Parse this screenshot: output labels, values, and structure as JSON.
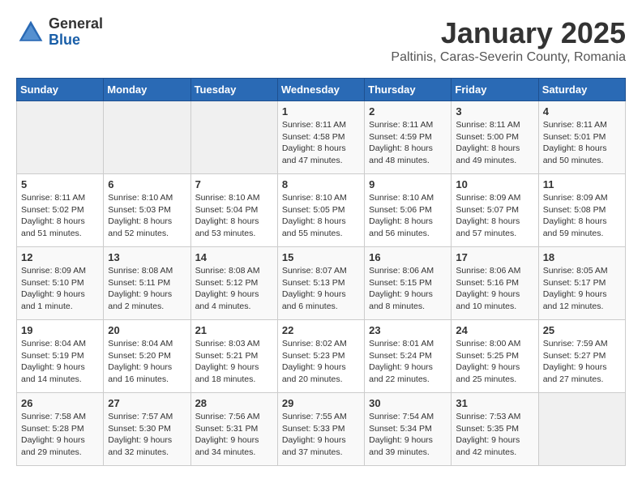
{
  "logo": {
    "general": "General",
    "blue": "Blue"
  },
  "header": {
    "title": "January 2025",
    "subtitle": "Paltinis, Caras-Severin County, Romania"
  },
  "weekdays": [
    "Sunday",
    "Monday",
    "Tuesday",
    "Wednesday",
    "Thursday",
    "Friday",
    "Saturday"
  ],
  "weeks": [
    [
      {
        "day": "",
        "info": ""
      },
      {
        "day": "",
        "info": ""
      },
      {
        "day": "",
        "info": ""
      },
      {
        "day": "1",
        "info": "Sunrise: 8:11 AM\nSunset: 4:58 PM\nDaylight: 8 hours and 47 minutes."
      },
      {
        "day": "2",
        "info": "Sunrise: 8:11 AM\nSunset: 4:59 PM\nDaylight: 8 hours and 48 minutes."
      },
      {
        "day": "3",
        "info": "Sunrise: 8:11 AM\nSunset: 5:00 PM\nDaylight: 8 hours and 49 minutes."
      },
      {
        "day": "4",
        "info": "Sunrise: 8:11 AM\nSunset: 5:01 PM\nDaylight: 8 hours and 50 minutes."
      }
    ],
    [
      {
        "day": "5",
        "info": "Sunrise: 8:11 AM\nSunset: 5:02 PM\nDaylight: 8 hours and 51 minutes."
      },
      {
        "day": "6",
        "info": "Sunrise: 8:10 AM\nSunset: 5:03 PM\nDaylight: 8 hours and 52 minutes."
      },
      {
        "day": "7",
        "info": "Sunrise: 8:10 AM\nSunset: 5:04 PM\nDaylight: 8 hours and 53 minutes."
      },
      {
        "day": "8",
        "info": "Sunrise: 8:10 AM\nSunset: 5:05 PM\nDaylight: 8 hours and 55 minutes."
      },
      {
        "day": "9",
        "info": "Sunrise: 8:10 AM\nSunset: 5:06 PM\nDaylight: 8 hours and 56 minutes."
      },
      {
        "day": "10",
        "info": "Sunrise: 8:09 AM\nSunset: 5:07 PM\nDaylight: 8 hours and 57 minutes."
      },
      {
        "day": "11",
        "info": "Sunrise: 8:09 AM\nSunset: 5:08 PM\nDaylight: 8 hours and 59 minutes."
      }
    ],
    [
      {
        "day": "12",
        "info": "Sunrise: 8:09 AM\nSunset: 5:10 PM\nDaylight: 9 hours and 1 minute."
      },
      {
        "day": "13",
        "info": "Sunrise: 8:08 AM\nSunset: 5:11 PM\nDaylight: 9 hours and 2 minutes."
      },
      {
        "day": "14",
        "info": "Sunrise: 8:08 AM\nSunset: 5:12 PM\nDaylight: 9 hours and 4 minutes."
      },
      {
        "day": "15",
        "info": "Sunrise: 8:07 AM\nSunset: 5:13 PM\nDaylight: 9 hours and 6 minutes."
      },
      {
        "day": "16",
        "info": "Sunrise: 8:06 AM\nSunset: 5:15 PM\nDaylight: 9 hours and 8 minutes."
      },
      {
        "day": "17",
        "info": "Sunrise: 8:06 AM\nSunset: 5:16 PM\nDaylight: 9 hours and 10 minutes."
      },
      {
        "day": "18",
        "info": "Sunrise: 8:05 AM\nSunset: 5:17 PM\nDaylight: 9 hours and 12 minutes."
      }
    ],
    [
      {
        "day": "19",
        "info": "Sunrise: 8:04 AM\nSunset: 5:19 PM\nDaylight: 9 hours and 14 minutes."
      },
      {
        "day": "20",
        "info": "Sunrise: 8:04 AM\nSunset: 5:20 PM\nDaylight: 9 hours and 16 minutes."
      },
      {
        "day": "21",
        "info": "Sunrise: 8:03 AM\nSunset: 5:21 PM\nDaylight: 9 hours and 18 minutes."
      },
      {
        "day": "22",
        "info": "Sunrise: 8:02 AM\nSunset: 5:23 PM\nDaylight: 9 hours and 20 minutes."
      },
      {
        "day": "23",
        "info": "Sunrise: 8:01 AM\nSunset: 5:24 PM\nDaylight: 9 hours and 22 minutes."
      },
      {
        "day": "24",
        "info": "Sunrise: 8:00 AM\nSunset: 5:25 PM\nDaylight: 9 hours and 25 minutes."
      },
      {
        "day": "25",
        "info": "Sunrise: 7:59 AM\nSunset: 5:27 PM\nDaylight: 9 hours and 27 minutes."
      }
    ],
    [
      {
        "day": "26",
        "info": "Sunrise: 7:58 AM\nSunset: 5:28 PM\nDaylight: 9 hours and 29 minutes."
      },
      {
        "day": "27",
        "info": "Sunrise: 7:57 AM\nSunset: 5:30 PM\nDaylight: 9 hours and 32 minutes."
      },
      {
        "day": "28",
        "info": "Sunrise: 7:56 AM\nSunset: 5:31 PM\nDaylight: 9 hours and 34 minutes."
      },
      {
        "day": "29",
        "info": "Sunrise: 7:55 AM\nSunset: 5:33 PM\nDaylight: 9 hours and 37 minutes."
      },
      {
        "day": "30",
        "info": "Sunrise: 7:54 AM\nSunset: 5:34 PM\nDaylight: 9 hours and 39 minutes."
      },
      {
        "day": "31",
        "info": "Sunrise: 7:53 AM\nSunset: 5:35 PM\nDaylight: 9 hours and 42 minutes."
      },
      {
        "day": "",
        "info": ""
      }
    ]
  ]
}
